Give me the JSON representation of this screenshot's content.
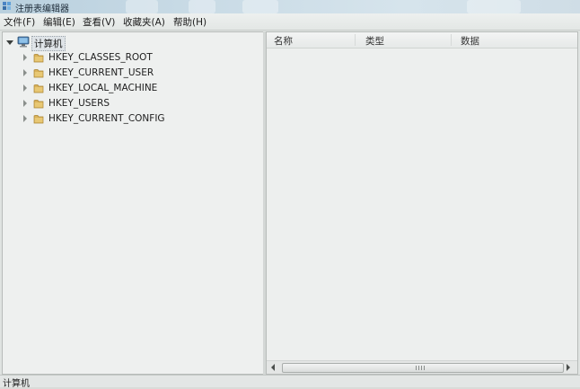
{
  "window": {
    "title": "注册表编辑器"
  },
  "menu": {
    "items": [
      {
        "label": "文件(F)"
      },
      {
        "label": "编辑(E)"
      },
      {
        "label": "查看(V)"
      },
      {
        "label": "收藏夹(A)"
      },
      {
        "label": "帮助(H)"
      }
    ]
  },
  "tree": {
    "root": {
      "label": "计算机",
      "icon": "computer-icon",
      "expanded": true
    },
    "children": [
      {
        "label": "HKEY_CLASSES_ROOT",
        "icon": "folder-icon"
      },
      {
        "label": "HKEY_CURRENT_USER",
        "icon": "folder-icon"
      },
      {
        "label": "HKEY_LOCAL_MACHINE",
        "icon": "folder-icon"
      },
      {
        "label": "HKEY_USERS",
        "icon": "folder-icon"
      },
      {
        "label": "HKEY_CURRENT_CONFIG",
        "icon": "folder-icon"
      }
    ]
  },
  "list": {
    "columns": [
      {
        "label": "名称"
      },
      {
        "label": "类型"
      },
      {
        "label": "数据"
      }
    ],
    "rows": []
  },
  "statusbar": {
    "path": "计算机"
  },
  "colors": {
    "folder": "#d9b25a",
    "pane_background": "#eef0ef"
  }
}
